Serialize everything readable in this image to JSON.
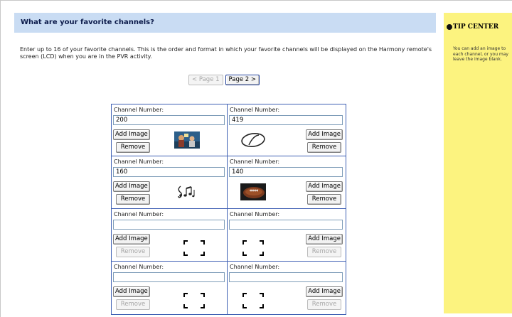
{
  "header": {
    "title": "What are your favorite channels?"
  },
  "intro": "Enter up to 16 of your favorite channels. This is the order and format in which your favorite channels will be displayed on the Harmony remote's screen (LCD) when you are in the PVR activity.",
  "pager": {
    "prev_label": "< Page 1",
    "next_label": "Page 2 >"
  },
  "channels": [
    {
      "label": "Channel Number:",
      "value": "200",
      "add_label": "Add Image",
      "remove_label": "Remove",
      "image": "tv-show-logo-icon",
      "remove_enabled": true
    },
    {
      "label": "Channel Number:",
      "value": "419",
      "add_label": "Add Image",
      "remove_label": "Remove",
      "image": "oval-logo-icon",
      "remove_enabled": true
    },
    {
      "label": "Channel Number:",
      "value": "160",
      "add_label": "Add Image",
      "remove_label": "Remove",
      "image": "music-notes-icon",
      "remove_enabled": true
    },
    {
      "label": "Channel Number:",
      "value": "140",
      "add_label": "Add Image",
      "remove_label": "Remove",
      "image": "football-icon",
      "remove_enabled": true
    },
    {
      "label": "Channel Number:",
      "value": "",
      "add_label": "Add Image",
      "remove_label": "Remove",
      "image": "empty-image-placeholder-icon",
      "remove_enabled": false
    },
    {
      "label": "Channel Number:",
      "value": "",
      "add_label": "Add Image",
      "remove_label": "Remove",
      "image": "empty-image-placeholder-icon",
      "remove_enabled": false
    },
    {
      "label": "Channel Number:",
      "value": "",
      "add_label": "Add Image",
      "remove_label": "Remove",
      "image": "empty-image-placeholder-icon",
      "remove_enabled": false
    },
    {
      "label": "Channel Number:",
      "value": "",
      "add_label": "Add Image",
      "remove_label": "Remove",
      "image": "empty-image-placeholder-icon",
      "remove_enabled": false
    }
  ],
  "tip": {
    "title": "TIP CENTER",
    "text": "You can add an image to\neach channel, or you may\nleave the image blank."
  },
  "colors": {
    "header_bg": "#c9dcf3",
    "grid_border": "#3e5fb3",
    "tip_bg": "#fcf37f"
  }
}
